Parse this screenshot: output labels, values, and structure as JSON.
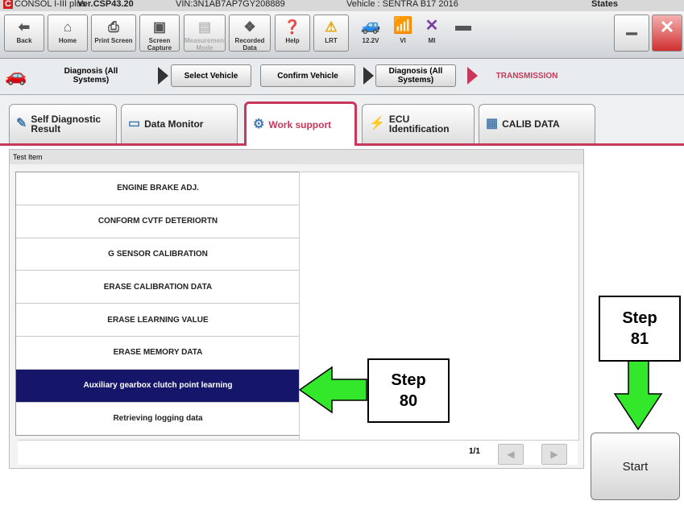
{
  "titlebar": {
    "app": "CONSOL I-III plus",
    "version": "Ver.CSP43.20",
    "vin": "VIN:3N1AB7AP7GY208889",
    "vehicle": "Vehicle : SENTRA B17 2016",
    "region": "States"
  },
  "toolbar": {
    "back": "Back",
    "home": "Home",
    "print_screen": "Print Screen",
    "screen_capture": "Screen Capture",
    "measurement_mode": "Measurement Mode",
    "recorded_data": "Recorded Data",
    "help": "Help",
    "lrt": "LRT",
    "voltage": "12.2V",
    "vi": "VI",
    "mi": "MI"
  },
  "breadcrumbs": {
    "diag_all_1": "Diagnosis (All Systems)",
    "select_vehicle": "Select Vehicle",
    "confirm_vehicle": "Confirm Vehicle",
    "diag_all_2": "Diagnosis (All Systems)",
    "current": "TRANSMISSION"
  },
  "tabs": [
    {
      "label": "Self Diagnostic Result"
    },
    {
      "label": "Data Monitor"
    },
    {
      "label": "Work support"
    },
    {
      "label": "ECU Identification"
    },
    {
      "label": "CALIB DATA"
    }
  ],
  "panel": {
    "header": "Test Item",
    "items": [
      "ENGINE BRAKE ADJ.",
      "CONFORM CVTF DETERIORTN",
      "G SENSOR CALIBRATION",
      "ERASE CALIBRATION DATA",
      "ERASE LEARNING VALUE",
      "ERASE MEMORY DATA",
      "Auxiliary gearbox clutch point learning",
      "Retrieving logging data"
    ],
    "selected_index": 6,
    "page": "1/1"
  },
  "start_label": "Start",
  "callouts": {
    "step80_line1": "Step",
    "step80_line2": "80",
    "step81_line1": "Step",
    "step81_line2": "81"
  },
  "colors": {
    "accent": "#c8385a",
    "selected_row": "#151669",
    "arrow_green": "#33e82a"
  }
}
